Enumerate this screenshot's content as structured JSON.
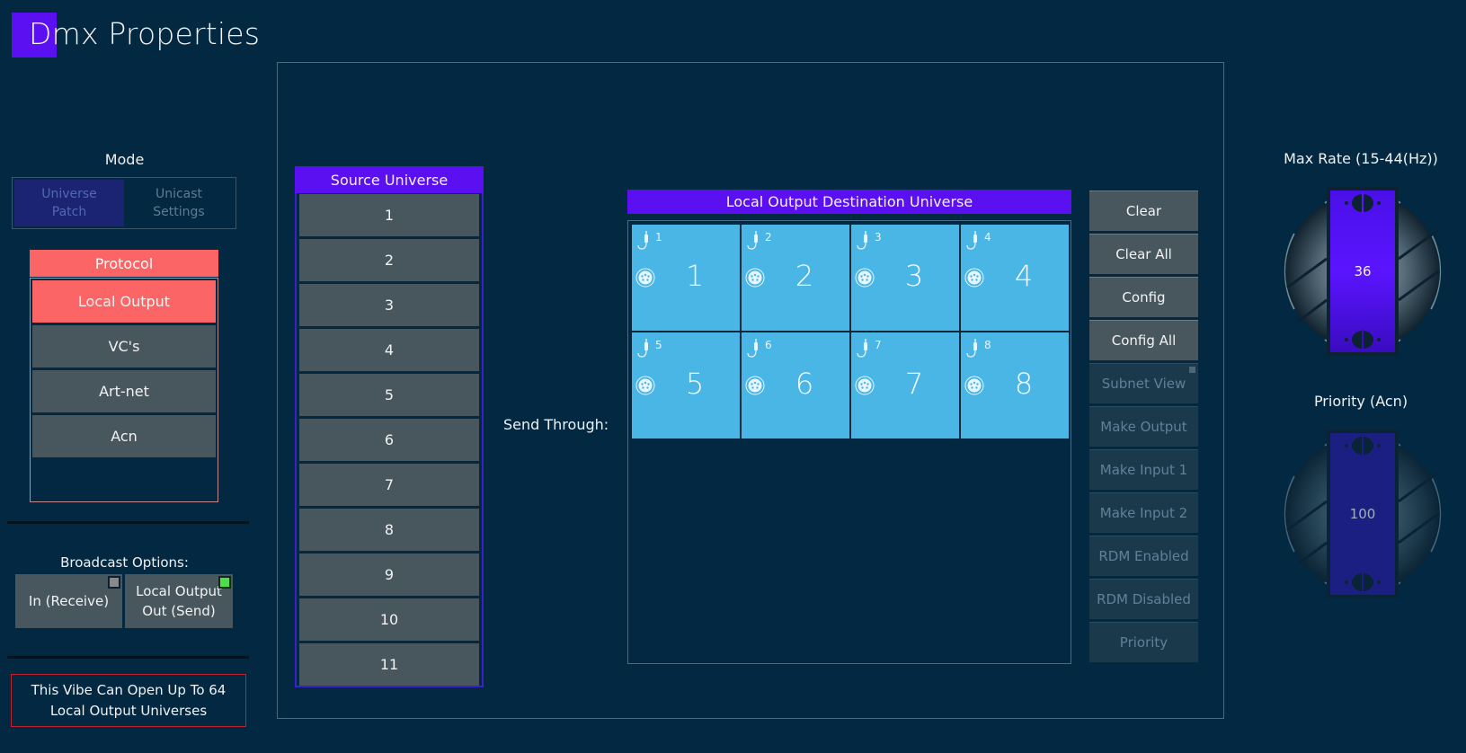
{
  "header": {
    "title": "Dmx Properties"
  },
  "mode": {
    "label": "Mode",
    "options": [
      {
        "label_line1": "Universe",
        "label_line2": "Patch",
        "active": true
      },
      {
        "label_line1": "Unicast",
        "label_line2": "Settings",
        "active": false
      }
    ]
  },
  "protocol": {
    "header": "Protocol",
    "items": [
      {
        "label": "Local Output",
        "active": true
      },
      {
        "label": "VC's",
        "active": false
      },
      {
        "label": "Art-net",
        "active": false
      },
      {
        "label": "Acn",
        "active": false
      }
    ]
  },
  "broadcast": {
    "label": "Broadcast Options:",
    "receive": {
      "label": "In (Receive)",
      "led": "off"
    },
    "send": {
      "label_line1": "Local Output",
      "label_line2": "Out (Send)",
      "led": "on"
    }
  },
  "info": {
    "line1": "This Vibe Can Open Up To 64",
    "line2": "Local Output Universes"
  },
  "source": {
    "header": "Source Universe",
    "items": [
      "1",
      "2",
      "3",
      "4",
      "5",
      "6",
      "7",
      "8",
      "9",
      "10",
      "11"
    ]
  },
  "send_through_label": "Send Through:",
  "destination": {
    "header": "Local Output Destination Universe",
    "cells": [
      {
        "port": "1",
        "universe": "1"
      },
      {
        "port": "2",
        "universe": "2"
      },
      {
        "port": "3",
        "universe": "3"
      },
      {
        "port": "4",
        "universe": "4"
      },
      {
        "port": "5",
        "universe": "5"
      },
      {
        "port": "6",
        "universe": "6"
      },
      {
        "port": "7",
        "universe": "7"
      },
      {
        "port": "8",
        "universe": "8"
      }
    ]
  },
  "actions": [
    {
      "label": "Clear",
      "enabled": true
    },
    {
      "label": "Clear All",
      "enabled": true
    },
    {
      "label": "Config",
      "enabled": true
    },
    {
      "label": "Config All",
      "enabled": true
    },
    {
      "label": "Subnet View",
      "enabled": false,
      "indicator": true
    },
    {
      "label": "Make Output",
      "enabled": false
    },
    {
      "label": "Make Input 1",
      "enabled": false
    },
    {
      "label": "Make Input 2",
      "enabled": false
    },
    {
      "label": "RDM Enabled",
      "enabled": false
    },
    {
      "label": "RDM Disabled",
      "enabled": false
    },
    {
      "label": "Priority",
      "enabled": false
    }
  ],
  "max_rate": {
    "label": "Max Rate (15-44(Hz))",
    "value": "36",
    "min": 15,
    "max": 44
  },
  "priority": {
    "label": "Priority (Acn)",
    "value": "100"
  },
  "colors": {
    "background": "#032942",
    "accent_purple": "#5a10f0",
    "protocol_red": "#fb6565",
    "cell_blue": "#4ab6e6",
    "button_gray": "#48575e",
    "led_on": "#4be04b"
  }
}
